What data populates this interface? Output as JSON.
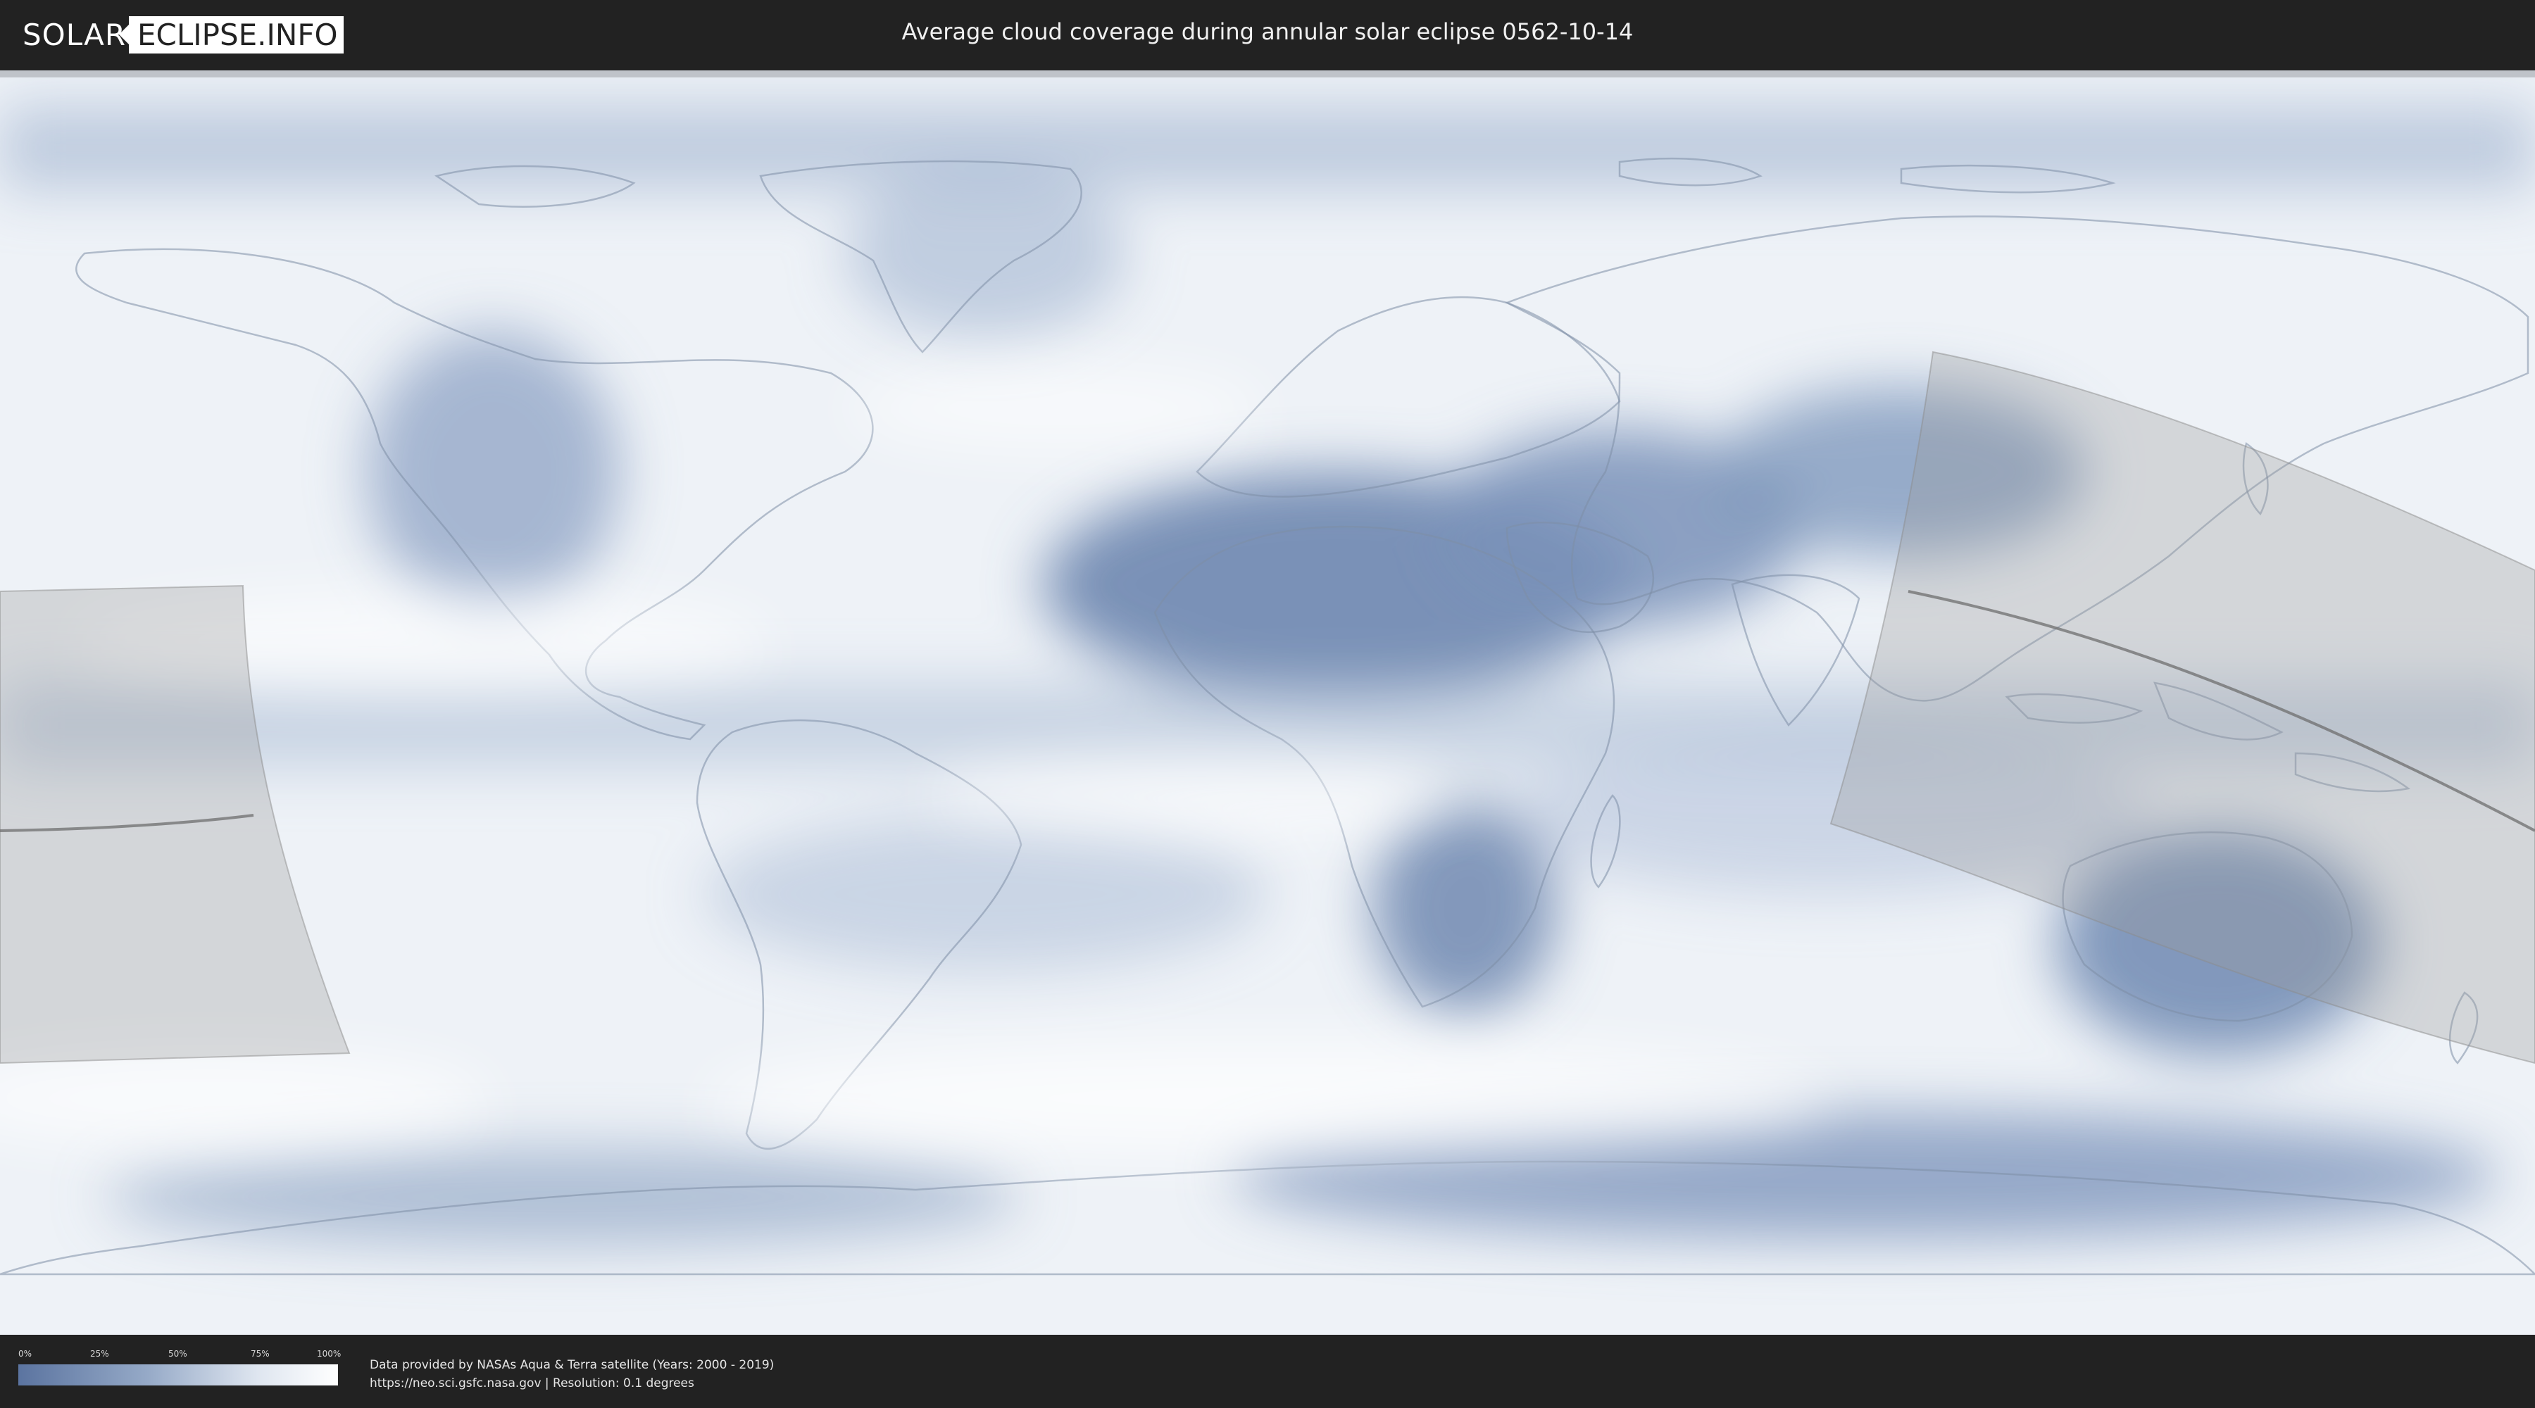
{
  "header": {
    "logo_left": "SOLAR",
    "logo_right": "ECLIPSE.INFO",
    "title": "Average cloud coverage during annular solar eclipse 0562-10-14"
  },
  "map": {
    "projection": "equirectangular world map",
    "palette": {
      "clear": "#5b74a0",
      "mid": "#95a9c7",
      "cloudy": "#ffffff",
      "eclipse_overlay": "#a8a8a8",
      "center_line": "#6e6e6e"
    }
  },
  "legend": {
    "labels": [
      "0%",
      "25%",
      "50%",
      "75%",
      "100%"
    ]
  },
  "credits": {
    "line1": "Data provided by NASAs Aqua & Terra satellite (Years: 2000 - 2019)",
    "line2": "https://neo.sci.gsfc.nasa.gov | Resolution: 0.1 degrees"
  }
}
